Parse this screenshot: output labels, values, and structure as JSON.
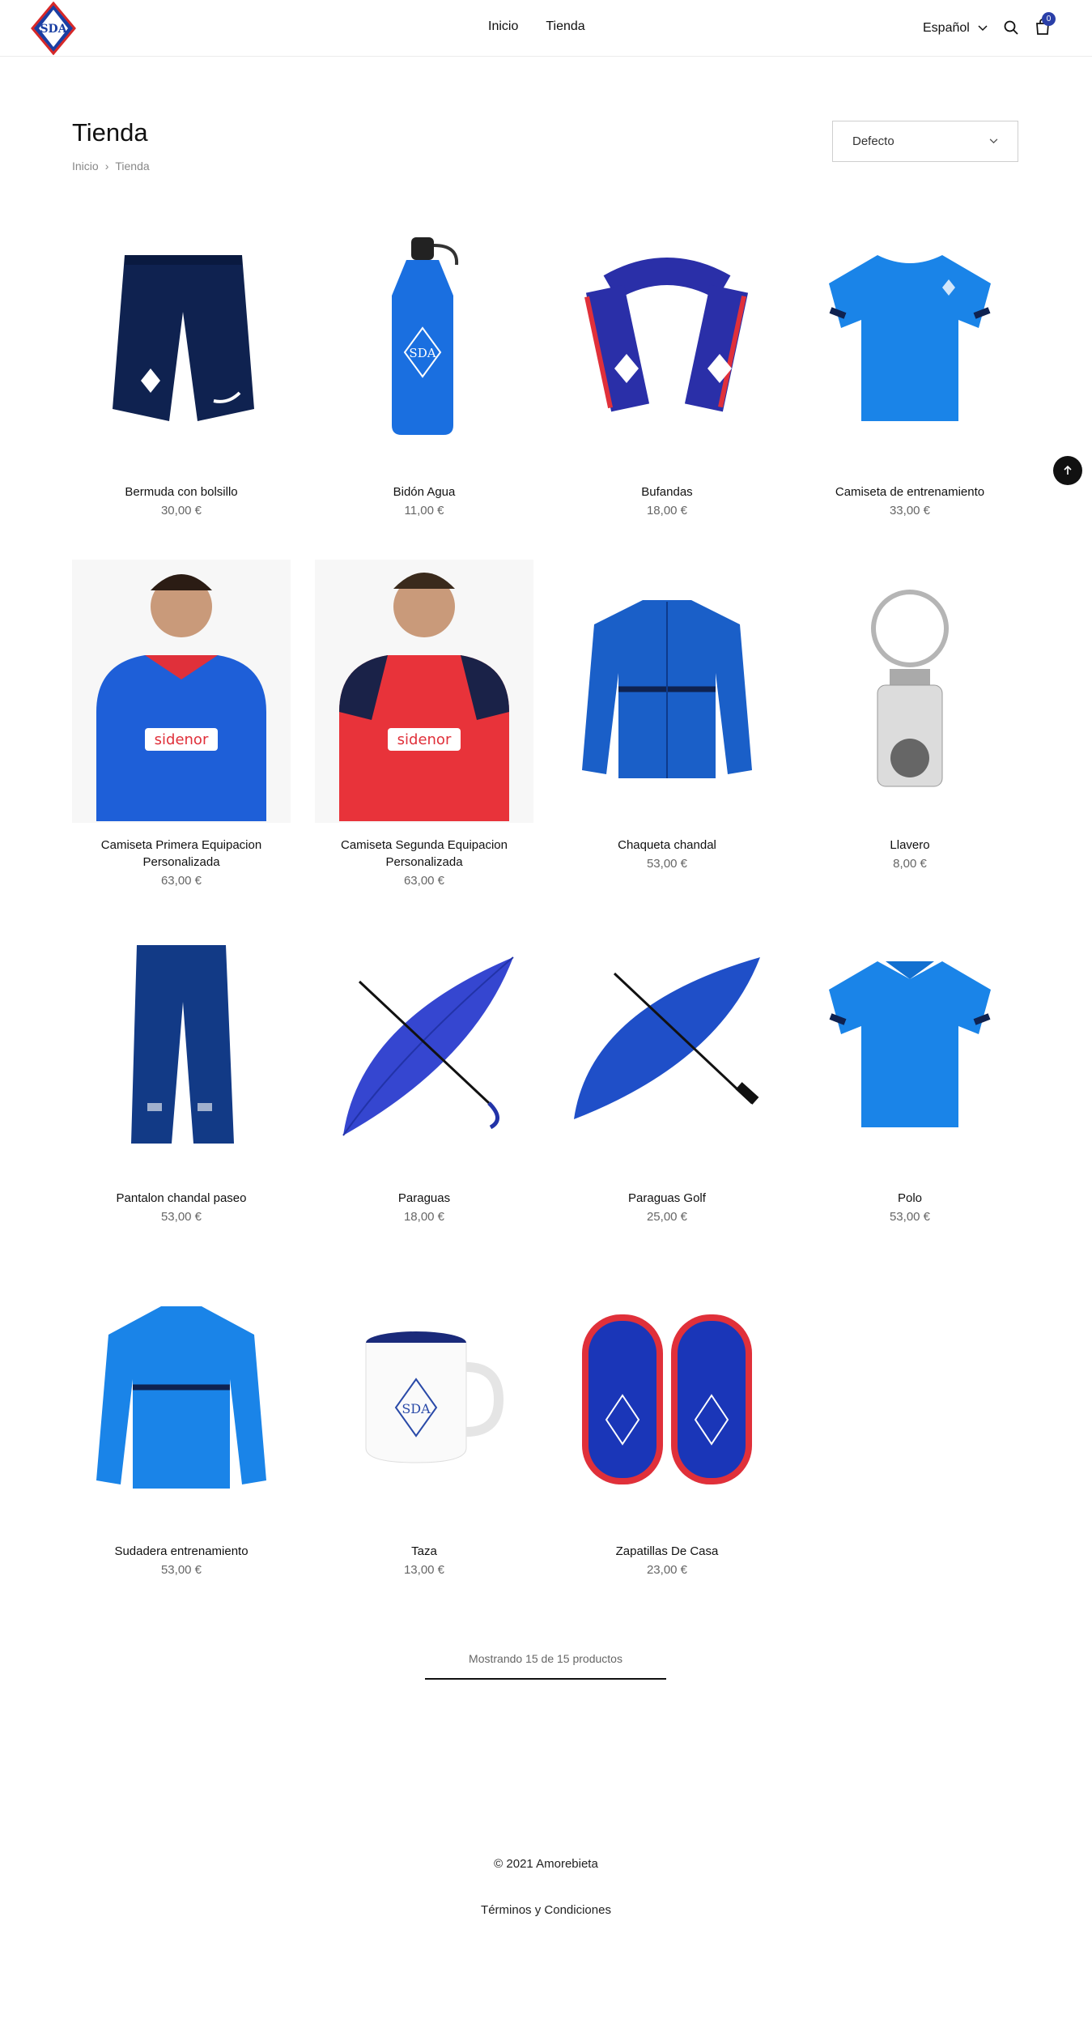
{
  "header": {
    "logo_text": "SDA",
    "nav": [
      "Inicio",
      "Tienda"
    ],
    "language": "Español",
    "cart_count": "0"
  },
  "page": {
    "title": "Tienda",
    "breadcrumb": [
      "Inicio",
      "Tienda"
    ],
    "sort_value": "Defecto"
  },
  "products": [
    {
      "name": "Bermuda con bolsillo",
      "price": "30,00 €",
      "icon": "shorts"
    },
    {
      "name": "Bidón Agua",
      "price": "11,00 €",
      "icon": "bottle"
    },
    {
      "name": "Bufandas",
      "price": "18,00 €",
      "icon": "scarf"
    },
    {
      "name": "Camiseta de entrenamiento",
      "price": "33,00 €",
      "icon": "tshirt"
    },
    {
      "name": "Camiseta Primera Equipacion Personalizada",
      "price": "63,00 €",
      "icon": "player-blue"
    },
    {
      "name": "Camiseta Segunda Equipacion Personalizada",
      "price": "63,00 €",
      "icon": "player-red"
    },
    {
      "name": "Chaqueta chandal",
      "price": "53,00 €",
      "icon": "jacket"
    },
    {
      "name": "Llavero",
      "price": "8,00 €",
      "icon": "keychain"
    },
    {
      "name": "Pantalon chandal paseo",
      "price": "53,00 €",
      "icon": "pants"
    },
    {
      "name": "Paraguas",
      "price": "18,00 €",
      "icon": "umbrella"
    },
    {
      "name": "Paraguas Golf",
      "price": "25,00 €",
      "icon": "umbrella-golf"
    },
    {
      "name": "Polo",
      "price": "53,00 €",
      "icon": "polo"
    },
    {
      "name": "Sudadera entrenamiento",
      "price": "53,00 €",
      "icon": "sweatshirt"
    },
    {
      "name": "Taza",
      "price": "13,00 €",
      "icon": "mug"
    },
    {
      "name": "Zapatillas De Casa",
      "price": "23,00 €",
      "icon": "slippers"
    }
  ],
  "result_count": "Mostrando 15 de 15 productos",
  "footer": {
    "copyright": "© 2021 Amorebieta",
    "terms": "Términos y Condiciones"
  },
  "colors": {
    "accent": "#2a3fa8",
    "royal_blue": "#1565d8",
    "navy": "#0f2250",
    "red": "#e0303a"
  }
}
